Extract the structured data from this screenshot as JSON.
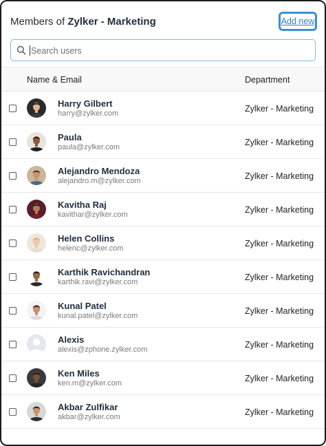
{
  "header": {
    "title_prefix": "Members of ",
    "title_group": "Zylker - Marketing",
    "add_new_label": "Add new"
  },
  "search": {
    "placeholder": "Search users",
    "value": "",
    "icon": "search-icon"
  },
  "table": {
    "columns": [
      "Name & Email",
      "Department"
    ],
    "rows": [
      {
        "name": "Harry Gilbert",
        "email": "harry@zylker.com",
        "department": "Zylker - Marketing",
        "avatar": {
          "bg": "#2b2b2b",
          "skin": "#e2b48f",
          "hair": "#1a1a1a",
          "shirt": "#3a3a3a"
        }
      },
      {
        "name": "Paula",
        "email": "paula@zylker.com",
        "department": "Zylker - Marketing",
        "avatar": {
          "bg": "#e8e3dc",
          "skin": "#8a5a3c",
          "hair": "#2b1b12",
          "shirt": "#1e1e1e"
        }
      },
      {
        "name": "Alejandro Mendoza",
        "email": "alejandro.m@zylker.com",
        "department": "Zylker - Marketing",
        "avatar": {
          "bg": "#c9b79b",
          "skin": "#c9956b",
          "hair": "#3a2a1c",
          "shirt": "#4a6a8a"
        }
      },
      {
        "name": "Kavitha Raj",
        "email": "kavithar@zylker.com",
        "department": "Zylker - Marketing",
        "avatar": {
          "bg": "#5a1f2a",
          "skin": "#b07a55",
          "hair": "#1e1210",
          "shirt": "#7a2232"
        }
      },
      {
        "name": "Helen Collins",
        "email": "helenc@zylker.com",
        "department": "Zylker - Marketing",
        "avatar": {
          "bg": "#efe6dc",
          "skin": "#eccaa8",
          "hair": "#d8b07a",
          "shirt": "#e9dccb"
        }
      },
      {
        "name": "Karthik Ravichandran",
        "email": "karthik.ravi@zylker.com",
        "department": "Zylker - Marketing",
        "avatar": {
          "bg": "#ffffff",
          "skin": "#9a6a48",
          "hair": "#1c1410",
          "shirt": "#2a2a2a"
        }
      },
      {
        "name": "Kunal Patel",
        "email": "kunal.patel@zylker.com",
        "department": "Zylker - Marketing",
        "avatar": {
          "bg": "#f3f3f3",
          "skin": "#c7916a",
          "hair": "#2a1c14",
          "shirt": "#dcdcdc"
        }
      },
      {
        "name": "Alexis",
        "email": "alexis@zphone.zylker.com",
        "department": "Zylker - Marketing",
        "avatar": {
          "bg": "#e4e8ee",
          "skin": "#ffffff",
          "hair": "#ffffff",
          "shirt": "#ffffff"
        }
      },
      {
        "name": "Ken Miles",
        "email": "ken.m@zylker.com",
        "department": "Zylker - Marketing",
        "avatar": {
          "bg": "#3a3a3a",
          "skin": "#7a5038",
          "hair": "#161616",
          "shirt": "#262626"
        }
      },
      {
        "name": "Akbar Zulfikar",
        "email": "akbar@zylker.com",
        "department": "Zylker - Marketing",
        "avatar": {
          "bg": "#d8d8d8",
          "skin": "#c8946c",
          "hair": "#1e1a18",
          "shirt": "#2e2e2e"
        }
      }
    ]
  }
}
